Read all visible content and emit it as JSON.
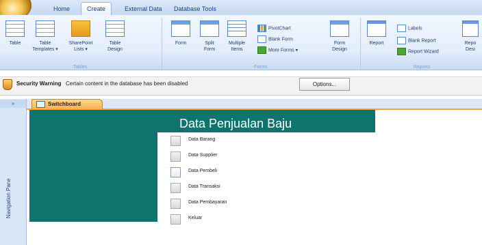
{
  "ribbon": {
    "tabs": [
      "Home",
      "Create",
      "External Data",
      "Database Tools"
    ],
    "active_tab": "Create",
    "tables": {
      "buttons": [
        "Table",
        "Table\nTemplates ▾",
        "SharePoint\nLists ▾",
        "Table\nDesign"
      ],
      "label": "Tables"
    },
    "forms": {
      "buttons": [
        "Form",
        "Split\nForm",
        "Multiple\nItems",
        "Form\nDesign"
      ],
      "small": [
        "PivotChart",
        "Blank Form",
        "More Forms ▾"
      ],
      "label": "Forms"
    },
    "reports": {
      "buttons": [
        "Report",
        "Repo\nDesi"
      ],
      "small": [
        "Labels",
        "Blank Report",
        "Report Wizard"
      ],
      "label": "Reports"
    }
  },
  "security": {
    "title": "Security Warning",
    "message": "Certain content in the database has been disabled",
    "options_label": "Options..."
  },
  "nav": {
    "toggle": "»",
    "label": "Navigation Pane"
  },
  "document": {
    "tab_label": "Switchboard",
    "form_title": "Data Penjualan Baju",
    "items": [
      "Data Barang",
      "Data Supplier",
      "Data Pembeli",
      "Data Transaksi",
      "Data Pembayaran",
      "Keluar"
    ]
  }
}
